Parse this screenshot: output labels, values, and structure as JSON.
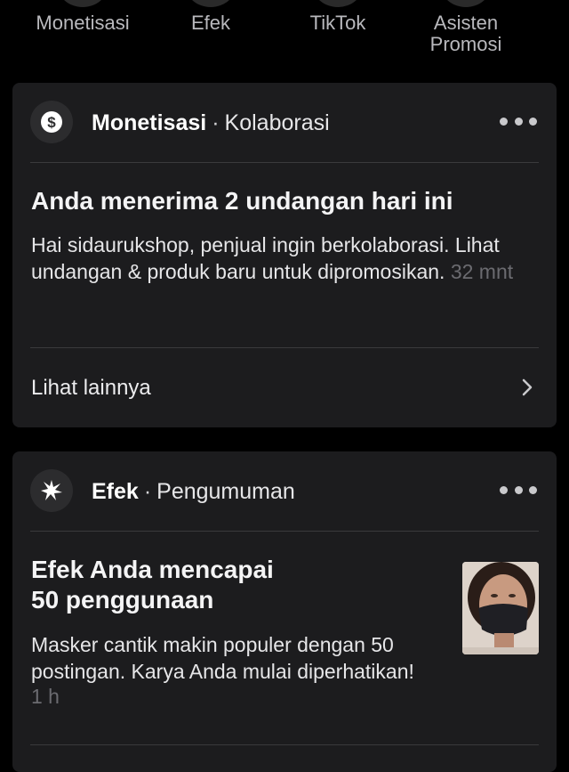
{
  "categories": [
    {
      "label": "Monetisasi"
    },
    {
      "label": "Efek"
    },
    {
      "label": "TikTok"
    },
    {
      "label": "Asisten Promosi"
    }
  ],
  "cards": [
    {
      "source": "Monetisasi",
      "separator": "·",
      "category": "Kolaborasi",
      "icon": "dollar-icon",
      "title": "Anda menerima 2 undangan hari ini",
      "body": "Hai sidaurukshop, penjual ingin berkolaborasi. Lihat undangan & produk baru untuk dipromosikan.",
      "time": "32 mnt",
      "see_more": "Lihat lainnya"
    },
    {
      "source": "Efek",
      "separator": "·",
      "category": "Pengumuman",
      "icon": "sparkle-burst-icon",
      "title_line1": "Efek Anda mencapai",
      "title_line2": "50 penggunaan",
      "body": "Masker cantik makin populer dengan 50 postingan. Karya Anda mulai diperhatikan!",
      "time": "1 h"
    }
  ],
  "colors": {
    "background": "#000000",
    "card": "#1c1c1e",
    "muted": "#6b6b70",
    "divider": "#3a3a3c"
  }
}
